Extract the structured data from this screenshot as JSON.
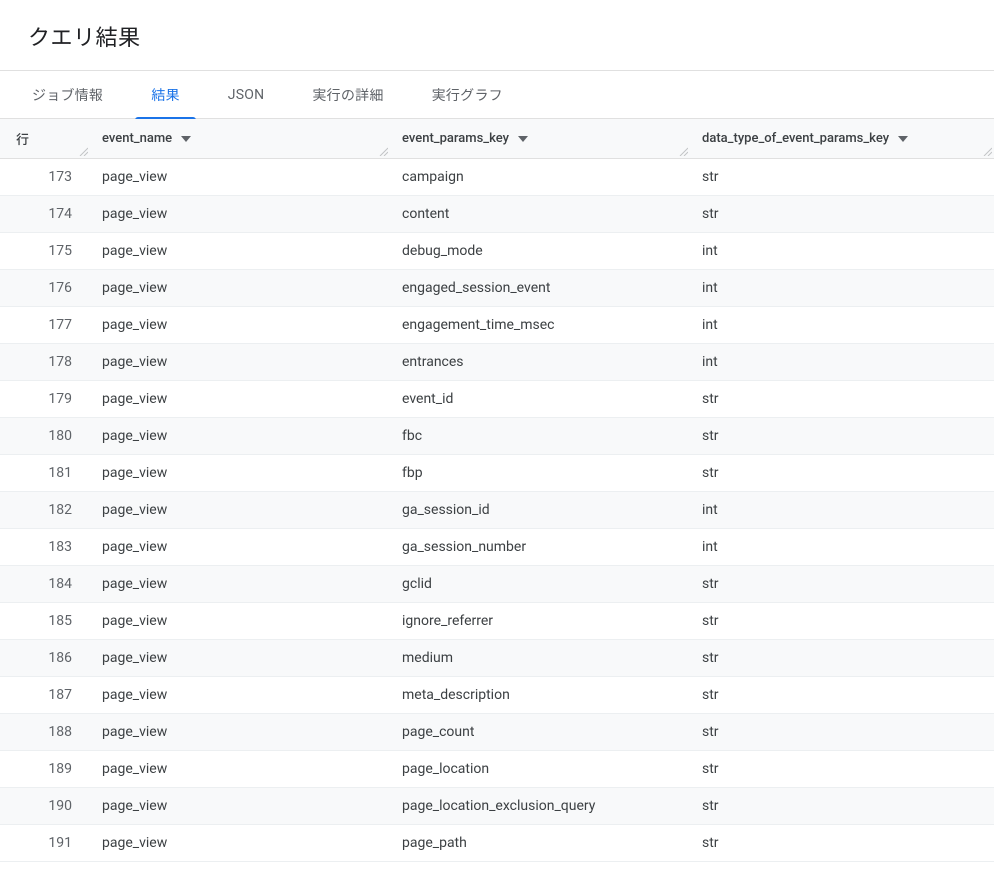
{
  "header": {
    "title": "クエリ結果"
  },
  "tabs": [
    {
      "label": "ジョブ情報",
      "active": false
    },
    {
      "label": "結果",
      "active": true
    },
    {
      "label": "JSON",
      "active": false
    },
    {
      "label": "実行の詳細",
      "active": false
    },
    {
      "label": "実行グラフ",
      "active": false
    }
  ],
  "table": {
    "columns": {
      "row": "行",
      "event_name": "event_name",
      "event_params_key": "event_params_key",
      "data_type": "data_type_of_event_params_key"
    },
    "rows": [
      {
        "n": 173,
        "event_name": "page_view",
        "event_params_key": "campaign",
        "data_type": "str"
      },
      {
        "n": 174,
        "event_name": "page_view",
        "event_params_key": "content",
        "data_type": "str"
      },
      {
        "n": 175,
        "event_name": "page_view",
        "event_params_key": "debug_mode",
        "data_type": "int"
      },
      {
        "n": 176,
        "event_name": "page_view",
        "event_params_key": "engaged_session_event",
        "data_type": "int"
      },
      {
        "n": 177,
        "event_name": "page_view",
        "event_params_key": "engagement_time_msec",
        "data_type": "int"
      },
      {
        "n": 178,
        "event_name": "page_view",
        "event_params_key": "entrances",
        "data_type": "int"
      },
      {
        "n": 179,
        "event_name": "page_view",
        "event_params_key": "event_id",
        "data_type": "str"
      },
      {
        "n": 180,
        "event_name": "page_view",
        "event_params_key": "fbc",
        "data_type": "str"
      },
      {
        "n": 181,
        "event_name": "page_view",
        "event_params_key": "fbp",
        "data_type": "str"
      },
      {
        "n": 182,
        "event_name": "page_view",
        "event_params_key": "ga_session_id",
        "data_type": "int"
      },
      {
        "n": 183,
        "event_name": "page_view",
        "event_params_key": "ga_session_number",
        "data_type": "int"
      },
      {
        "n": 184,
        "event_name": "page_view",
        "event_params_key": "gclid",
        "data_type": "str"
      },
      {
        "n": 185,
        "event_name": "page_view",
        "event_params_key": "ignore_referrer",
        "data_type": "str"
      },
      {
        "n": 186,
        "event_name": "page_view",
        "event_params_key": "medium",
        "data_type": "str"
      },
      {
        "n": 187,
        "event_name": "page_view",
        "event_params_key": "meta_description",
        "data_type": "str"
      },
      {
        "n": 188,
        "event_name": "page_view",
        "event_params_key": "page_count",
        "data_type": "str"
      },
      {
        "n": 189,
        "event_name": "page_view",
        "event_params_key": "page_location",
        "data_type": "str"
      },
      {
        "n": 190,
        "event_name": "page_view",
        "event_params_key": "page_location_exclusion_query",
        "data_type": "str"
      },
      {
        "n": 191,
        "event_name": "page_view",
        "event_params_key": "page_path",
        "data_type": "str"
      }
    ]
  }
}
